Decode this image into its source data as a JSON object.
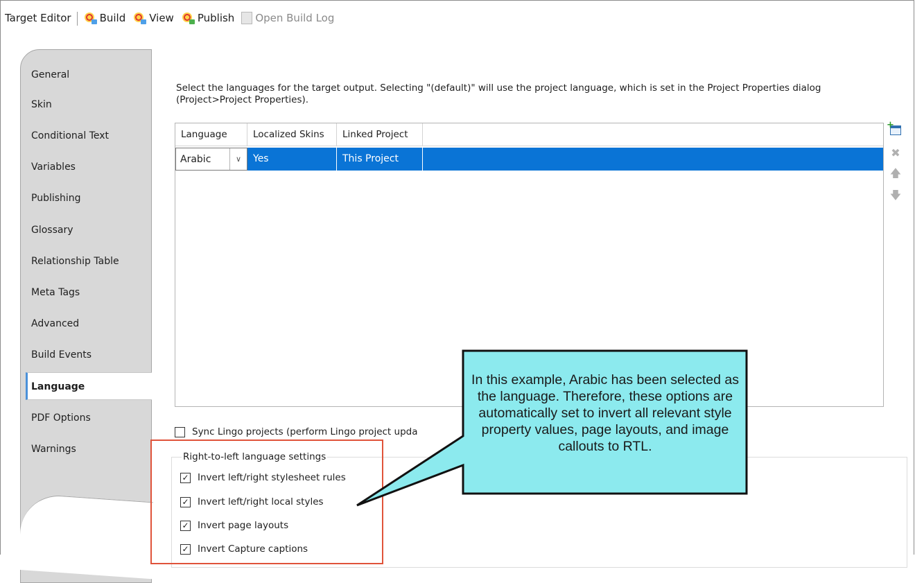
{
  "toolbar": {
    "title": "Target Editor",
    "build_label": "Build",
    "view_label": "View",
    "publish_label": "Publish",
    "open_build_log_label": "Open Build Log"
  },
  "sidebar": {
    "items": [
      {
        "label": "General"
      },
      {
        "label": "Skin"
      },
      {
        "label": "Conditional Text"
      },
      {
        "label": "Variables"
      },
      {
        "label": "Publishing"
      },
      {
        "label": "Glossary"
      },
      {
        "label": "Relationship Table"
      },
      {
        "label": "Meta Tags"
      },
      {
        "label": "Advanced"
      },
      {
        "label": "Build Events"
      },
      {
        "label": "Language"
      },
      {
        "label": "PDF Options"
      },
      {
        "label": "Warnings"
      }
    ],
    "active": "Language"
  },
  "main": {
    "description": "Select the languages for the target output. Selecting \"(default)\" will use the project language, which is set in the Project Properties dialog (Project>Project Properties).",
    "table": {
      "headers": [
        "Language",
        "Localized Skins",
        "Linked Project"
      ],
      "rows": [
        {
          "language": "Arabic",
          "localized_skins": "Yes",
          "linked_project": "This Project"
        }
      ]
    },
    "sync_label": "Sync Lingo projects (perform Lingo project upda",
    "rtl": {
      "legend": "Right-to-left language settings",
      "options": [
        {
          "label": "Invert left/right stylesheet rules",
          "checked": true
        },
        {
          "label": "Invert left/right local styles",
          "checked": true
        },
        {
          "label": "Invert page layouts",
          "checked": true
        },
        {
          "label": "Invert Capture captions",
          "checked": true
        }
      ]
    }
  },
  "callout": {
    "text": "In this example, Arabic has been selected as the language. Therefore, these options are automatically set to invert all relevant style property values, page layouts, and image callouts to RTL.",
    "fill": "#8ceaee",
    "highlight_color": "#e0533a"
  },
  "colors": {
    "selection": "#0a74d6",
    "active_tab_accent": "#4a90d9"
  }
}
